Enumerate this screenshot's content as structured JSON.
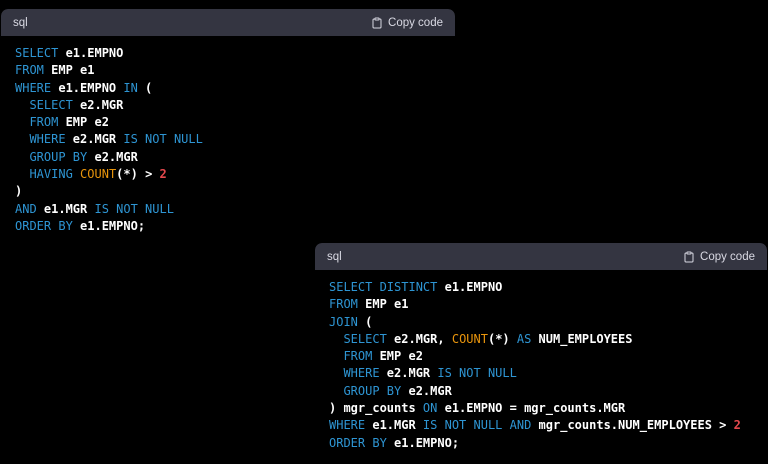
{
  "colors": {
    "page_background": "#000000",
    "header_bg": "#343541",
    "header_text": "#d9d9e3",
    "code_bg": "#000000",
    "keyword": "#2e95d3",
    "plain": "#ffffff",
    "builtin": "#e9950c",
    "number": "#e5484d"
  },
  "blocks": [
    {
      "language": "sql",
      "copy_label": "Copy code",
      "lines": [
        [
          {
            "t": "SELECT",
            "c": "kw"
          },
          {
            "t": " e1.EMPNO",
            "c": "pl"
          }
        ],
        [
          {
            "t": "FROM",
            "c": "kw"
          },
          {
            "t": " EMP e1",
            "c": "pl"
          }
        ],
        [
          {
            "t": "WHERE",
            "c": "kw"
          },
          {
            "t": " e1.EMPNO ",
            "c": "pl"
          },
          {
            "t": "IN",
            "c": "kw"
          },
          {
            "t": " (",
            "c": "pl"
          }
        ],
        [
          {
            "t": "  ",
            "c": "pl"
          },
          {
            "t": "SELECT",
            "c": "kw"
          },
          {
            "t": " e2.MGR",
            "c": "pl"
          }
        ],
        [
          {
            "t": "  ",
            "c": "pl"
          },
          {
            "t": "FROM",
            "c": "kw"
          },
          {
            "t": " EMP e2",
            "c": "pl"
          }
        ],
        [
          {
            "t": "  ",
            "c": "pl"
          },
          {
            "t": "WHERE",
            "c": "kw"
          },
          {
            "t": " e2.MGR ",
            "c": "pl"
          },
          {
            "t": "IS NOT NULL",
            "c": "kw"
          }
        ],
        [
          {
            "t": "  ",
            "c": "pl"
          },
          {
            "t": "GROUP BY",
            "c": "kw"
          },
          {
            "t": " e2.MGR",
            "c": "pl"
          }
        ],
        [
          {
            "t": "  ",
            "c": "pl"
          },
          {
            "t": "HAVING",
            "c": "kw"
          },
          {
            "t": " ",
            "c": "pl"
          },
          {
            "t": "COUNT",
            "c": "fn"
          },
          {
            "t": "(*) > ",
            "c": "pl"
          },
          {
            "t": "2",
            "c": "num"
          }
        ],
        [
          {
            "t": ")",
            "c": "pl"
          }
        ],
        [
          {
            "t": "AND",
            "c": "kw"
          },
          {
            "t": " e1.MGR ",
            "c": "pl"
          },
          {
            "t": "IS NOT NULL",
            "c": "kw"
          }
        ],
        [
          {
            "t": "ORDER BY",
            "c": "kw"
          },
          {
            "t": " e1.EMPNO;",
            "c": "pl"
          }
        ]
      ]
    },
    {
      "language": "sql",
      "copy_label": "Copy code",
      "lines": [
        [
          {
            "t": "SELECT DISTINCT",
            "c": "kw"
          },
          {
            "t": " e1.EMPNO",
            "c": "pl"
          }
        ],
        [
          {
            "t": "FROM",
            "c": "kw"
          },
          {
            "t": " EMP e1",
            "c": "pl"
          }
        ],
        [
          {
            "t": "JOIN",
            "c": "kw"
          },
          {
            "t": " (",
            "c": "pl"
          }
        ],
        [
          {
            "t": "  ",
            "c": "pl"
          },
          {
            "t": "SELECT",
            "c": "kw"
          },
          {
            "t": " e2.MGR, ",
            "c": "pl"
          },
          {
            "t": "COUNT",
            "c": "fn"
          },
          {
            "t": "(*) ",
            "c": "pl"
          },
          {
            "t": "AS",
            "c": "kw"
          },
          {
            "t": " NUM_EMPLOYEES",
            "c": "pl"
          }
        ],
        [
          {
            "t": "  ",
            "c": "pl"
          },
          {
            "t": "FROM",
            "c": "kw"
          },
          {
            "t": " EMP e2",
            "c": "pl"
          }
        ],
        [
          {
            "t": "  ",
            "c": "pl"
          },
          {
            "t": "WHERE",
            "c": "kw"
          },
          {
            "t": " e2.MGR ",
            "c": "pl"
          },
          {
            "t": "IS NOT NULL",
            "c": "kw"
          }
        ],
        [
          {
            "t": "  ",
            "c": "pl"
          },
          {
            "t": "GROUP BY",
            "c": "kw"
          },
          {
            "t": " e2.MGR",
            "c": "pl"
          }
        ],
        [
          {
            "t": ") mgr_counts ",
            "c": "pl"
          },
          {
            "t": "ON",
            "c": "kw"
          },
          {
            "t": " e1.EMPNO = mgr_counts.MGR",
            "c": "pl"
          }
        ],
        [
          {
            "t": "WHERE",
            "c": "kw"
          },
          {
            "t": " e1.MGR ",
            "c": "pl"
          },
          {
            "t": "IS NOT NULL",
            "c": "kw"
          },
          {
            "t": " ",
            "c": "pl"
          },
          {
            "t": "AND",
            "c": "kw"
          },
          {
            "t": " mgr_counts.NUM_EMPLOYEES > ",
            "c": "pl"
          },
          {
            "t": "2",
            "c": "num"
          }
        ],
        [
          {
            "t": "ORDER BY",
            "c": "kw"
          },
          {
            "t": " e1.EMPNO;",
            "c": "pl"
          }
        ]
      ]
    }
  ]
}
